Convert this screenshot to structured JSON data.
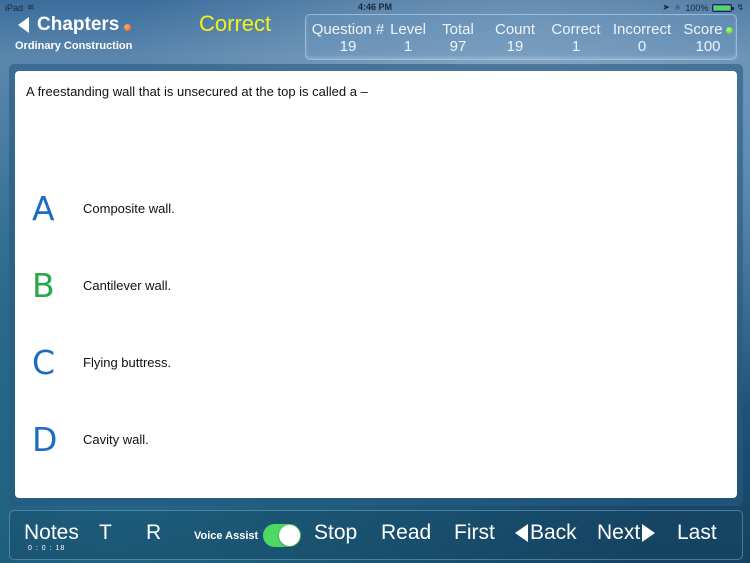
{
  "status_bar": {
    "device": "iPad",
    "time": "4:46 PM",
    "battery_percent": "100%",
    "battery_level": 1.0
  },
  "header": {
    "back_label": "Chapters",
    "chapter_name": "Ordinary Construction",
    "result": "Correct",
    "result_color": "#f2f21a"
  },
  "stats": [
    {
      "label": "Question #",
      "value": "19"
    },
    {
      "label": "Level",
      "value": "1"
    },
    {
      "label": "Total",
      "value": "97"
    },
    {
      "label": "Count",
      "value": "19"
    },
    {
      "label": "Correct",
      "value": "1"
    },
    {
      "label": "Incorrect",
      "value": "0"
    },
    {
      "label": "Score",
      "value": "100"
    }
  ],
  "question": {
    "text": "A freestanding wall that is unsecured at the top is called a –",
    "options": [
      {
        "letter": "A",
        "text": "Composite wall.",
        "color": "#1f6bbf"
      },
      {
        "letter": "B",
        "text": "Cantilever wall.",
        "color": "#2aa84a"
      },
      {
        "letter": "C",
        "text": "Flying buttress.",
        "color": "#1f6bbf"
      },
      {
        "letter": "D",
        "text": "Cavity wall.",
        "color": "#1f6bbf"
      }
    ]
  },
  "toolbar": {
    "notes_label": "Notes",
    "timer": "0 : 0 : 18",
    "t_label": "T",
    "r_label": "R",
    "voice_assist_label": "Voice Assist",
    "voice_assist_on": true,
    "stop_label": "Stop",
    "read_label": "Read",
    "first_label": "First",
    "back_label": "Back",
    "next_label": "Next",
    "last_label": "Last"
  }
}
